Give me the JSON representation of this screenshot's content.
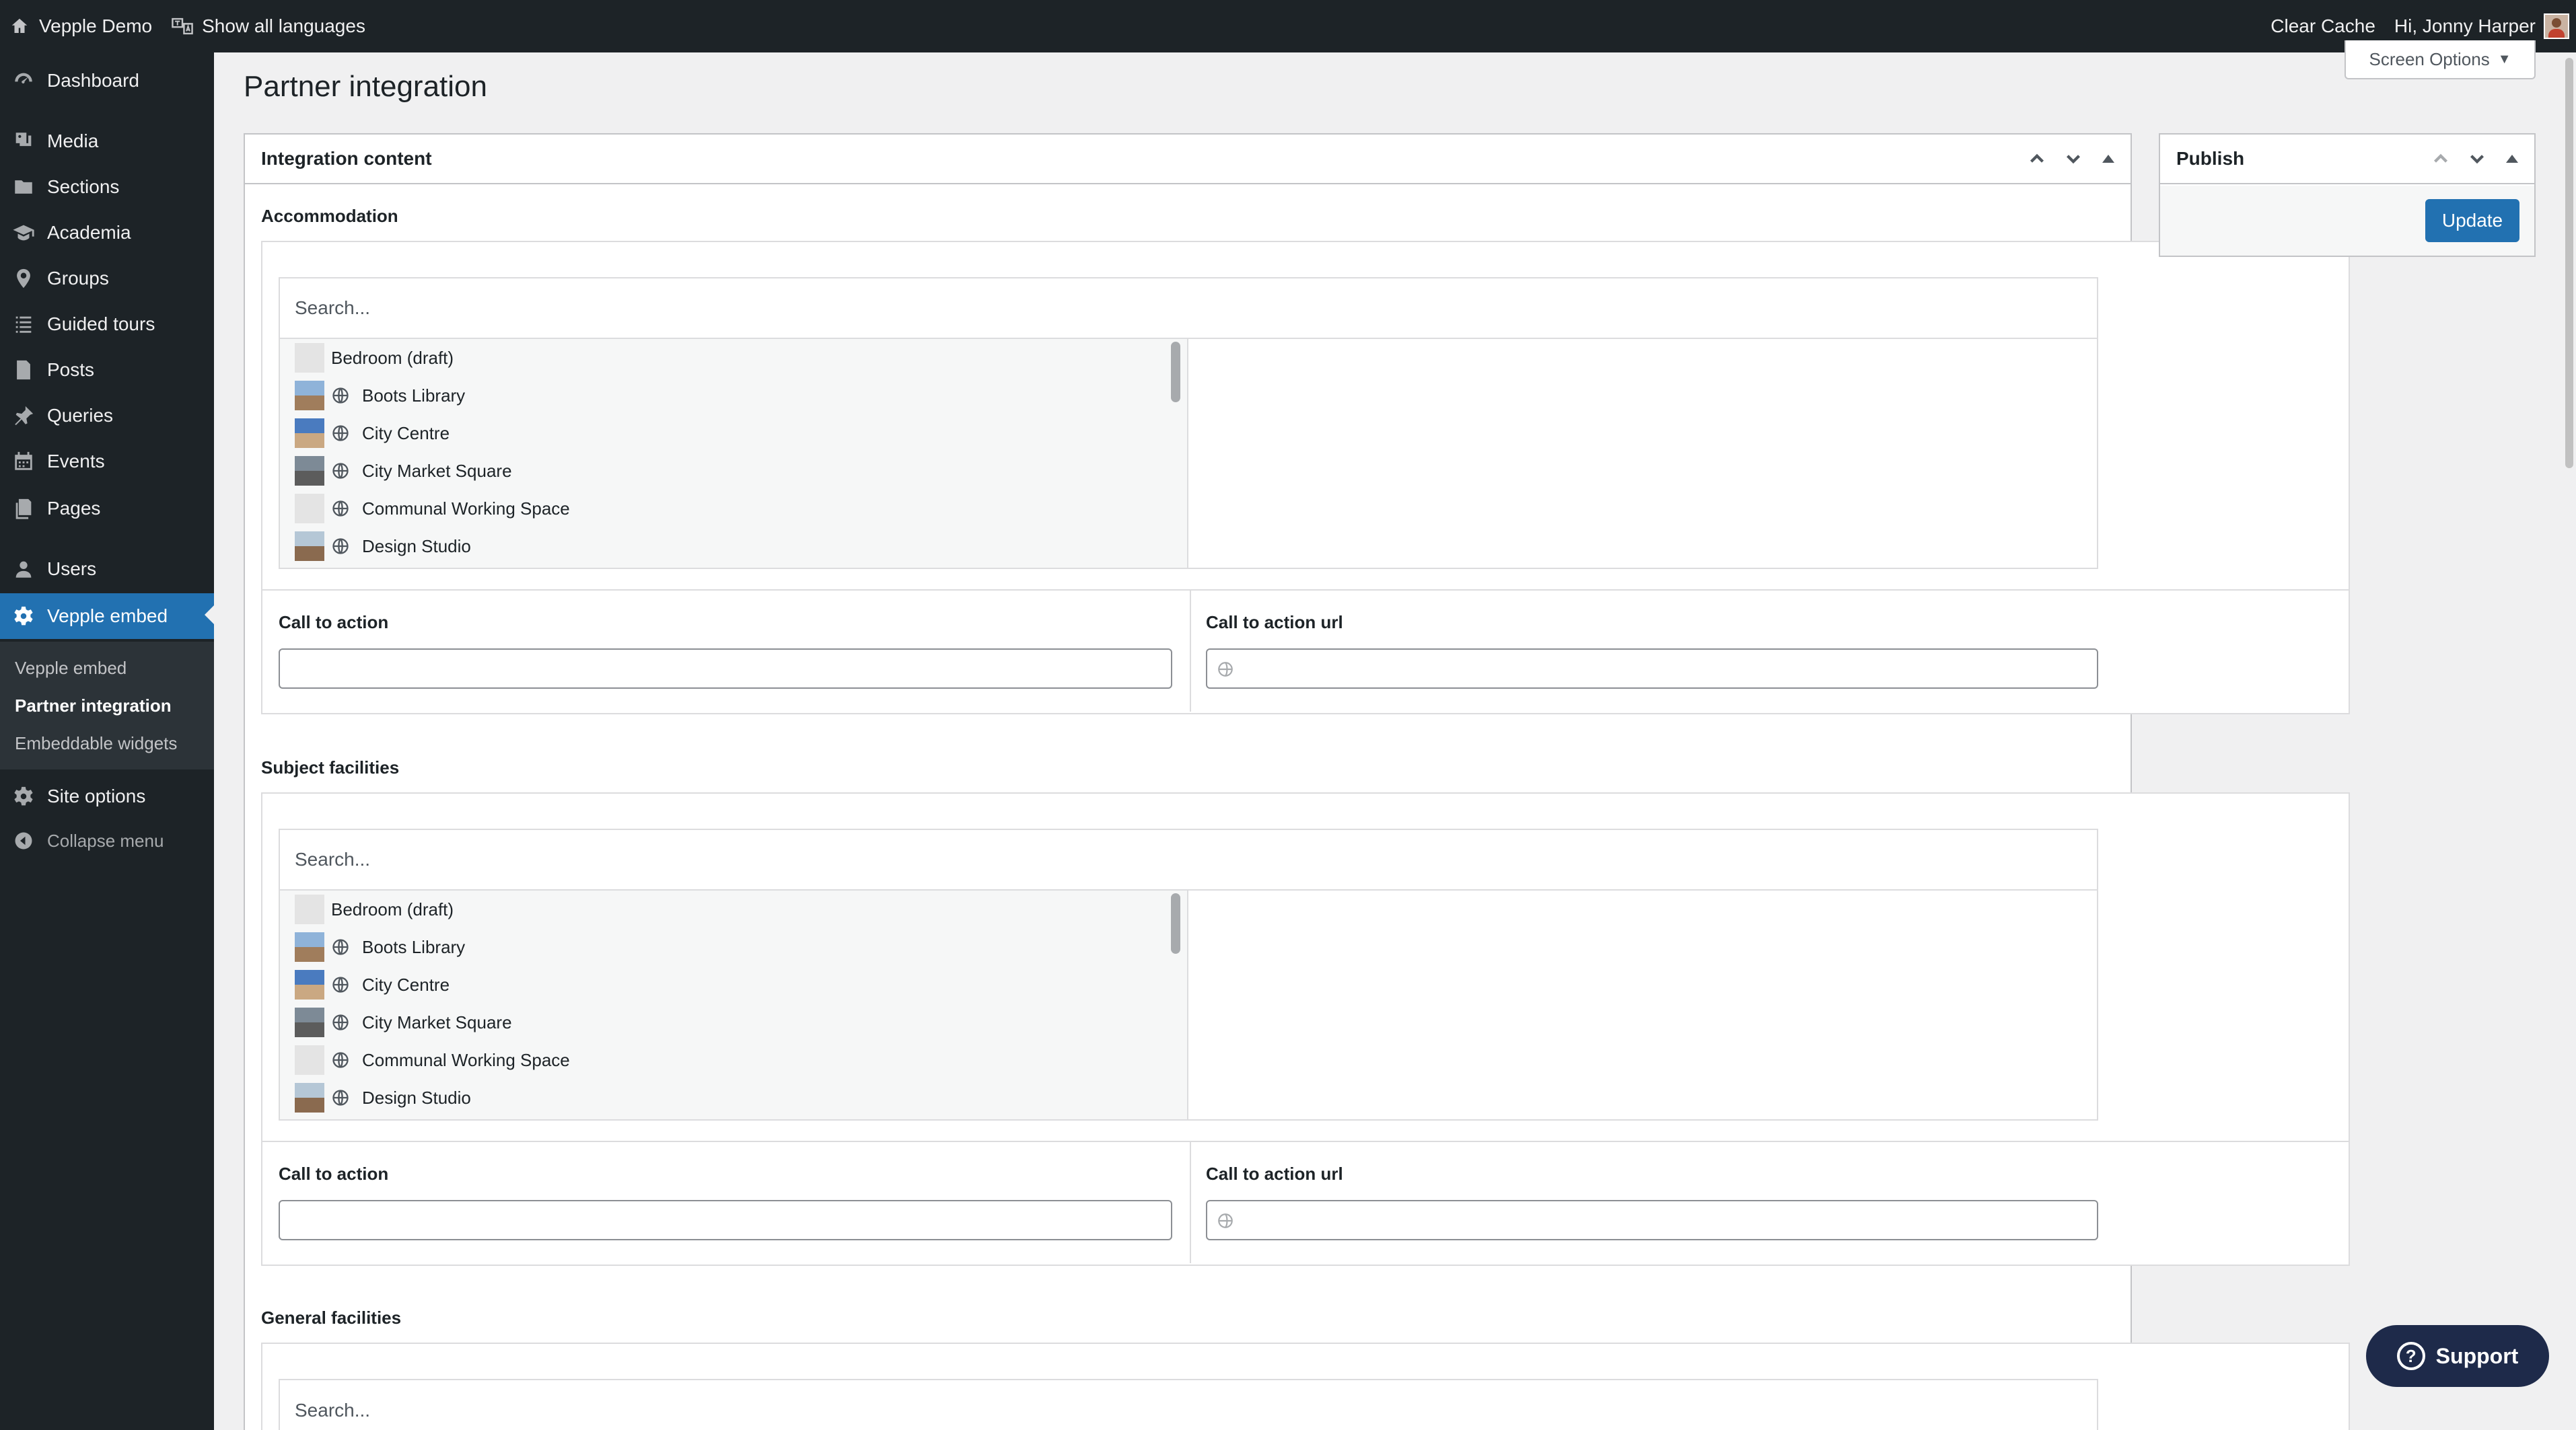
{
  "adminbar": {
    "site_name": "Vepple Demo",
    "languages": "Show all languages",
    "clear_cache": "Clear Cache",
    "greeting": "Hi, Jonny Harper"
  },
  "sidebar": {
    "items": [
      {
        "label": "Dashboard",
        "icon": "dashboard-icon"
      },
      {
        "label": "Media",
        "icon": "media-icon"
      },
      {
        "label": "Sections",
        "icon": "folder-icon"
      },
      {
        "label": "Academia",
        "icon": "graduation-cap-icon"
      },
      {
        "label": "Groups",
        "icon": "location-pin-icon"
      },
      {
        "label": "Guided tours",
        "icon": "list-icon"
      },
      {
        "label": "Posts",
        "icon": "posts-icon"
      },
      {
        "label": "Queries",
        "icon": "pushpin-icon"
      },
      {
        "label": "Events",
        "icon": "calendar-icon"
      },
      {
        "label": "Pages",
        "icon": "pages-icon"
      },
      {
        "label": "Users",
        "icon": "users-icon"
      },
      {
        "label": "Vepple embed",
        "icon": "gear-icon"
      },
      {
        "label": "Site options",
        "icon": "gear-icon"
      }
    ],
    "submenu": [
      "Vepple embed",
      "Partner integration",
      "Embeddable widgets"
    ],
    "collapse": "Collapse menu"
  },
  "page": {
    "title": "Partner integration",
    "screen_options": "Screen Options"
  },
  "integration_box": {
    "title": "Integration content",
    "sections": [
      {
        "label": "Accommodation"
      },
      {
        "label": "Subject facilities"
      },
      {
        "label": "General facilities"
      }
    ],
    "search_placeholder": "Search...",
    "choices": [
      {
        "label": "Bedroom (draft)",
        "thumb": "none",
        "globe": false
      },
      {
        "label": "Boots Library",
        "thumb": "img",
        "globe": true
      },
      {
        "label": "City Centre",
        "thumb": "img2",
        "globe": true
      },
      {
        "label": "City Market Square",
        "thumb": "img3",
        "globe": true
      },
      {
        "label": "Communal Working Space",
        "thumb": "none",
        "globe": true
      },
      {
        "label": "Design Studio",
        "thumb": "img4",
        "globe": true
      }
    ],
    "cta_label": "Call to action",
    "cta_url_label": "Call to action url"
  },
  "publish_box": {
    "title": "Publish",
    "update": "Update"
  },
  "support": {
    "label": "Support"
  }
}
